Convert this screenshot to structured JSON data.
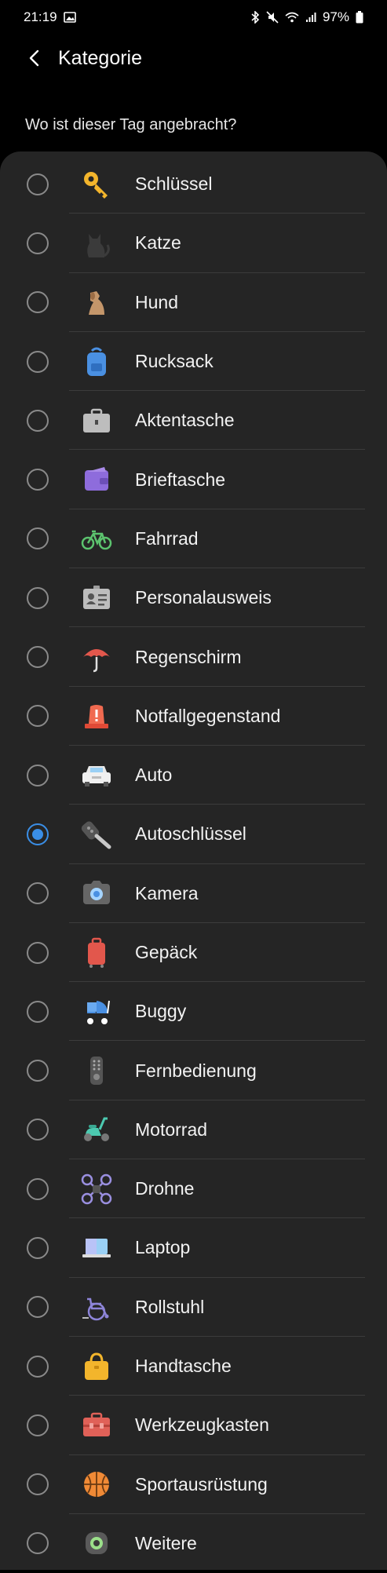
{
  "status_bar": {
    "time": "21:19",
    "battery": "97%",
    "icons": [
      "gallery-icon",
      "bluetooth-icon",
      "mute-icon",
      "wifi-icon",
      "signal-icon",
      "battery-icon"
    ]
  },
  "app_bar": {
    "title": "Kategorie",
    "back_icon": "chevron-left-icon"
  },
  "question": "Wo ist dieser Tag angebracht?",
  "colors": {
    "background": "#000000",
    "list_background": "#252525",
    "accent": "#3a8ee6",
    "divider": "#3c3c3c"
  },
  "categories": [
    {
      "label": "Schlüssel",
      "icon": "key-icon",
      "selected": false
    },
    {
      "label": "Katze",
      "icon": "cat-icon",
      "selected": false
    },
    {
      "label": "Hund",
      "icon": "dog-icon",
      "selected": false
    },
    {
      "label": "Rucksack",
      "icon": "backpack-icon",
      "selected": false
    },
    {
      "label": "Aktentasche",
      "icon": "briefcase-icon",
      "selected": false
    },
    {
      "label": "Brieftasche",
      "icon": "wallet-icon",
      "selected": false
    },
    {
      "label": "Fahrrad",
      "icon": "bicycle-icon",
      "selected": false
    },
    {
      "label": "Personalausweis",
      "icon": "id-card-icon",
      "selected": false
    },
    {
      "label": "Regenschirm",
      "icon": "umbrella-icon",
      "selected": false
    },
    {
      "label": "Notfallgegenstand",
      "icon": "emergency-light-icon",
      "selected": false
    },
    {
      "label": "Auto",
      "icon": "car-icon",
      "selected": false
    },
    {
      "label": "Autoschlüssel",
      "icon": "car-key-icon",
      "selected": true
    },
    {
      "label": "Kamera",
      "icon": "camera-icon",
      "selected": false
    },
    {
      "label": "Gepäck",
      "icon": "luggage-icon",
      "selected": false
    },
    {
      "label": "Buggy",
      "icon": "stroller-icon",
      "selected": false
    },
    {
      "label": "Fernbedienung",
      "icon": "remote-control-icon",
      "selected": false
    },
    {
      "label": "Motorrad",
      "icon": "scooter-icon",
      "selected": false
    },
    {
      "label": "Drohne",
      "icon": "drone-icon",
      "selected": false
    },
    {
      "label": "Laptop",
      "icon": "laptop-icon",
      "selected": false
    },
    {
      "label": "Rollstuhl",
      "icon": "wheelchair-icon",
      "selected": false
    },
    {
      "label": "Handtasche",
      "icon": "handbag-icon",
      "selected": false
    },
    {
      "label": "Werkzeugkasten",
      "icon": "toolbox-icon",
      "selected": false
    },
    {
      "label": "Sportausrüstung",
      "icon": "basketball-icon",
      "selected": false
    },
    {
      "label": "Weitere",
      "icon": "tag-icon",
      "selected": false
    }
  ]
}
